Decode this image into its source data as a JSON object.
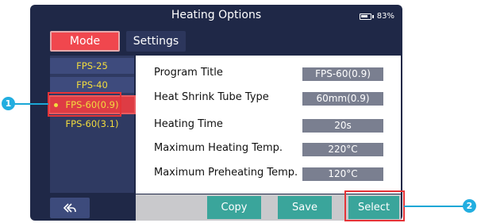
{
  "window": {
    "title": "Heating Options",
    "battery_percent": "83%",
    "battery_level": 0.83
  },
  "tabs": [
    {
      "label": "Mode",
      "active": true
    },
    {
      "label": "Settings",
      "active": false
    }
  ],
  "programs": [
    {
      "label": "FPS-25",
      "selected": false
    },
    {
      "label": "FPS-40",
      "selected": false
    },
    {
      "label": "FPS-60(0.9)",
      "selected": true
    },
    {
      "label": "FPS-60(3.1)",
      "selected": false
    }
  ],
  "back_button": {
    "icon": "reply-all-icon"
  },
  "settings": [
    {
      "label": "Program Title",
      "value": "FPS-60(0.9)"
    },
    {
      "label": "Heat Shrink Tube Type",
      "value": "60mm(0.9)"
    },
    {
      "label": "Heating Time",
      "value": "20s"
    },
    {
      "label": "Maximum Heating Temp.",
      "value": "220°C"
    },
    {
      "label": "Maximum Preheating Temp.",
      "value": "120°C"
    }
  ],
  "actions": {
    "copy": "Copy",
    "save": "Save",
    "select": "Select"
  },
  "callouts": [
    {
      "number": "1"
    },
    {
      "number": "2"
    }
  ],
  "colors": {
    "accent_red": "#f0474e",
    "action_teal": "#3aa59b",
    "callout_blue": "#22aee0",
    "screen_bg": "#1f2847"
  }
}
